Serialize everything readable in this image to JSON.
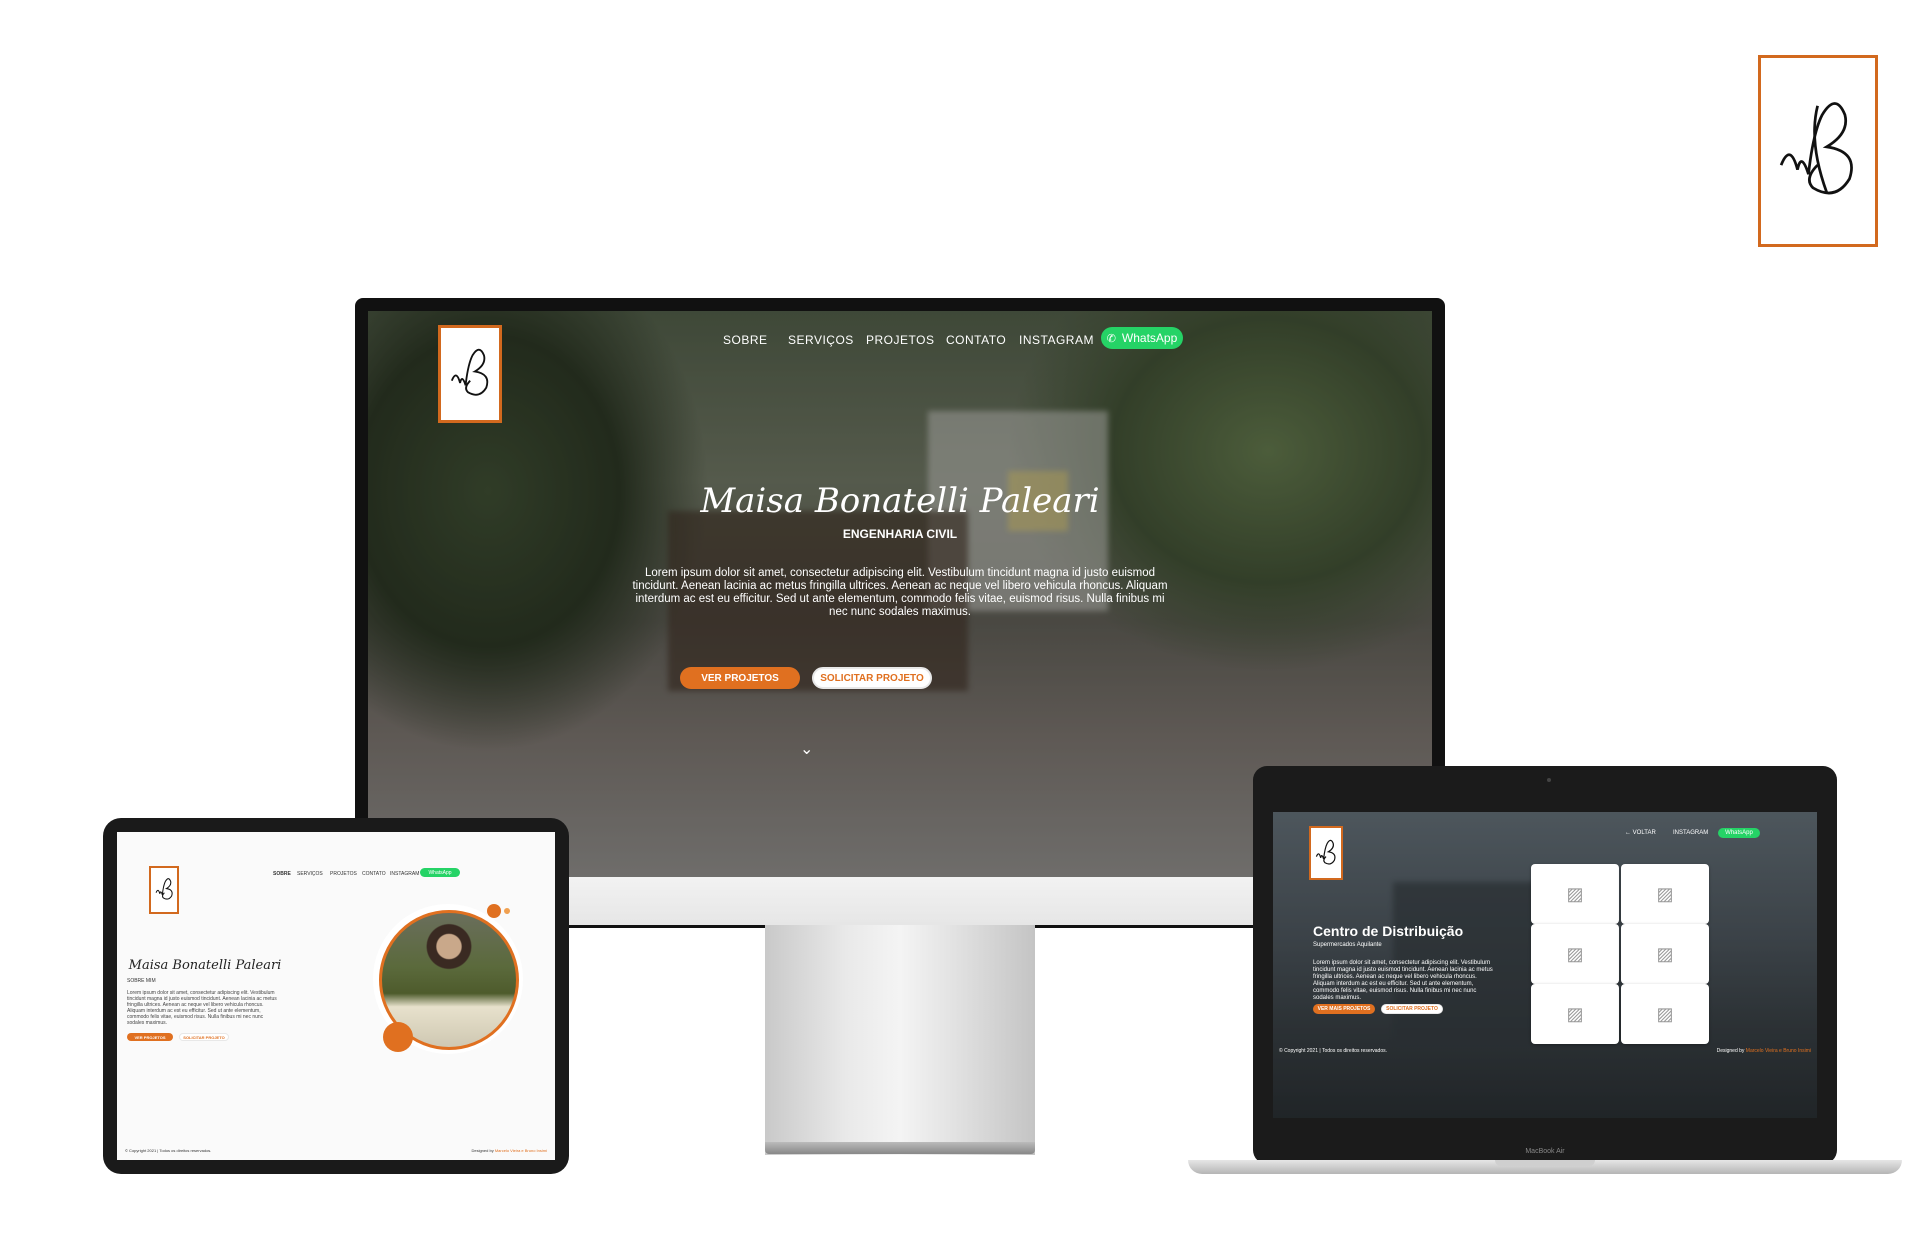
{
  "brand": {
    "logo_initials": "MBP",
    "accent_color": "#e07020",
    "whatsapp_color": "#25d366"
  },
  "desktop": {
    "nav": [
      "SOBRE",
      "SERVIÇOS",
      "PROJETOS",
      "CONTATO",
      "INSTAGRAM"
    ],
    "whatsapp_label": "WhatsApp",
    "name": "Maisa Bonatelli Paleari",
    "subtitle": "ENGENHARIA CIVIL",
    "description": "Lorem ipsum dolor sit amet, consectetur adipiscing elit. Vestibulum tincidunt magna id justo euismod tincidunt. Aenean lacinia ac metus fringilla ultrices. Aenean ac neque vel libero vehicula rhoncus. Aliquam interdum ac est eu efficitur. Sed ut ante elementum, commodo felis vitae, euismod risus. Nulla finibus mi nec nunc sodales maximus.",
    "primary_button": "VER PROJETOS",
    "secondary_button": "SOLICITAR PROJETO"
  },
  "tablet": {
    "nav": [
      "SOBRE",
      "SERVIÇOS",
      "PROJETOS",
      "CONTATO",
      "INSTAGRAM"
    ],
    "whatsapp_label": "WhatsApp",
    "name": "Maisa Bonatelli Paleari",
    "section": "SOBRE MIM",
    "description": "Lorem ipsum dolor sit amet, consectetur adipiscing elit. Vestibulum tincidunt magna id justo euismod tincidunt. Aenean lacinia ac metus fringilla ultrices. Aenean ac neque vel libero vehicula rhoncus. Aliquam interdum ac est eu efficitur. Sed ut ante elementum, commodo felis vitae, euismod risus. Nulla finibus mi nec nunc sodales maximus.",
    "primary_button": "VER PROJETOS",
    "secondary_button": "SOLICITAR PROJETO",
    "footer_left": "© Copyright 2021 | Todos os direitos reservados.",
    "footer_right_prefix": "Designed by",
    "footer_right_names": "Marcelo Vieira e Bruno Insimi"
  },
  "laptop": {
    "nav_back": "VOLTAR",
    "nav_instagram": "INSTAGRAM",
    "whatsapp_label": "WhatsApp",
    "project_title": "Centro de Distribuição",
    "project_client": "Supermercados Aquilante",
    "description": "Lorem ipsum dolor sit amet, consectetur adipiscing elit. Vestibulum tincidunt magna id justo euismod tincidunt. Aenean lacinia ac metus fringilla ultrices. Aenean ac neque vel libero vehicula rhoncus. Aliquam interdum ac est eu efficitur. Sed ut ante elementum, commodo felis vitae, euismod risus. Nulla finibus mi nec nunc sodales maximus.",
    "primary_button": "VER MAIS PROJETOS",
    "secondary_button": "SOLICITAR PROJETO",
    "footer_left": "© Copyright 2021 | Todos os direitos reservados.",
    "footer_right_prefix": "Designed by",
    "footer_right_names": "Marcelo Vieira e Bruno Insimi",
    "device_label": "MacBook Air",
    "thumbnail_icon": "image-placeholder-icon"
  }
}
